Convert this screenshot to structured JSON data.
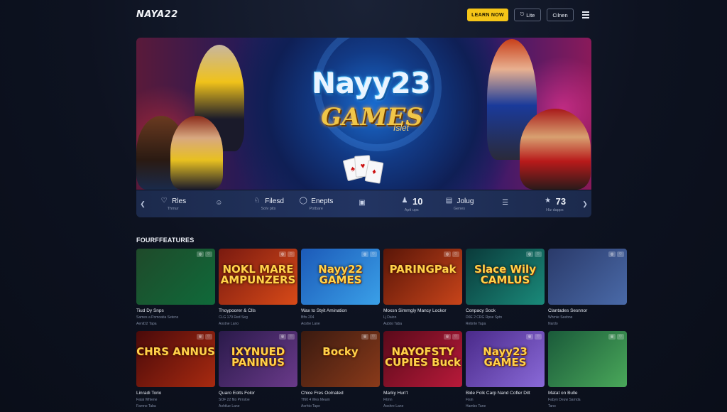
{
  "header": {
    "logo": "NAYA22",
    "learn_label": "LEARN NOW",
    "lite_label": "Lite",
    "client_label": "Cilnen"
  },
  "hero": {
    "title": "Nayy23",
    "subtitle": "GAMES",
    "tagline": "Islet"
  },
  "stats": {
    "prev_icon": "chevron-left-icon",
    "next_icon": "chevron-right-icon",
    "items": [
      {
        "icon": "heart-icon",
        "value": "Rles",
        "label": "Thmur"
      },
      {
        "icon": "smile-icon",
        "value": "",
        "label": ""
      },
      {
        "icon": "users-icon",
        "value": "Filesd",
        "label": "Solv pits"
      },
      {
        "icon": "shield-icon",
        "value": "Enepts",
        "label": "Potbare"
      },
      {
        "icon": "wallet-icon",
        "value": "",
        "label": ""
      },
      {
        "icon": "person-icon",
        "value": "10",
        "label": "Apti ups"
      },
      {
        "icon": "card-icon",
        "value": "Jolug",
        "label": "Genes"
      },
      {
        "icon": "list-icon",
        "value": "",
        "label": ""
      },
      {
        "icon": "star-icon",
        "value": "73",
        "label": "Hiz dapps"
      }
    ]
  },
  "features": {
    "title": "FOURFFEATURES",
    "row1": [
      {
        "thumb_text": "",
        "title": "Tiud Dy Snps",
        "sub": "Sames a Pomoatia Setens",
        "sub2": "AeniD2 Tapa",
        "colors": [
          "#1f4a2a",
          "#0f6a3a"
        ]
      },
      {
        "thumb_text": "NOKL MARE AMPUNZERS",
        "title": "Thoypoorer & Clls",
        "sub": "CLG 179 Red Seg",
        "sub2": "Aostne Lano",
        "colors": [
          "#7a1a10",
          "#d84a18"
        ]
      },
      {
        "thumb_text": "Nayy22 GAMES",
        "title": "Wax to Styit Amination",
        "sub": "Bfts 204",
        "sub2": "Aoshe Lane",
        "colors": [
          "#1c5ab8",
          "#3aa0e8"
        ]
      },
      {
        "thumb_text": "PARINGPak",
        "title": "Moxsn Simrngly Mancy Lockor",
        "sub": "Lj Daion",
        "sub2": "Aubtsi Taba",
        "colors": [
          "#5a1608",
          "#c8441a"
        ]
      },
      {
        "thumb_text": "Slace Wily CAMLUS",
        "title": "Conpacy Sock",
        "sub": "D0E 2 CRG Rpse Sptn",
        "sub2": "Rebnte Tapa",
        "colors": [
          "#0a3a3a",
          "#1a8a7a"
        ]
      },
      {
        "thumb_text": "",
        "title": "Clantades Sesnnor",
        "sub": "Whrnie Seebne",
        "sub2": "Nardo",
        "colors": [
          "#2a3a6a",
          "#4a6aa8"
        ]
      }
    ],
    "row2": [
      {
        "thumb_text": "CHRS ANNUS",
        "title": "Linradi Torio",
        "sub": "Fatai Whlene",
        "sub2": "Famno Taba",
        "colors": [
          "#4a0a0a",
          "#a82a10"
        ]
      },
      {
        "thumb_text": "IXYNUED PANINUS",
        "title": "Quaro Eolts Folor",
        "sub": "SOF 22 fito Pirrsloe",
        "sub2": "Aohtlue Lane",
        "colors": [
          "#2a1a4a",
          "#6a3a8a"
        ]
      },
      {
        "thumb_text": "Bocky",
        "title": "Chice Fres Oolnated",
        "sub": "Tf60 4 Wes Meam",
        "sub2": "Aorhto Tape",
        "colors": [
          "#3a1a10",
          "#8a3a1a"
        ]
      },
      {
        "thumb_text": "NAYOFSTY CUPIES Buck",
        "title": "Marky Hun't",
        "sub": "Fitmn",
        "sub2": "Aoshre Lane",
        "colors": [
          "#5a0a1a",
          "#b81a3a"
        ]
      },
      {
        "thumb_text": "Nayy23 GAMES",
        "title": "Bide Folk Carp Nand Cofler Dilt",
        "sub": "Fisin",
        "sub2": "Hambo Tane",
        "colors": [
          "#4a2a8a",
          "#8a6ad8"
        ]
      },
      {
        "thumb_text": "",
        "title": "Matat on Bulle",
        "sub": "Fabyn Deuw Sarnda",
        "sub2": "Tano",
        "colors": [
          "#1a5a3a",
          "#4aa85a"
        ]
      }
    ]
  }
}
